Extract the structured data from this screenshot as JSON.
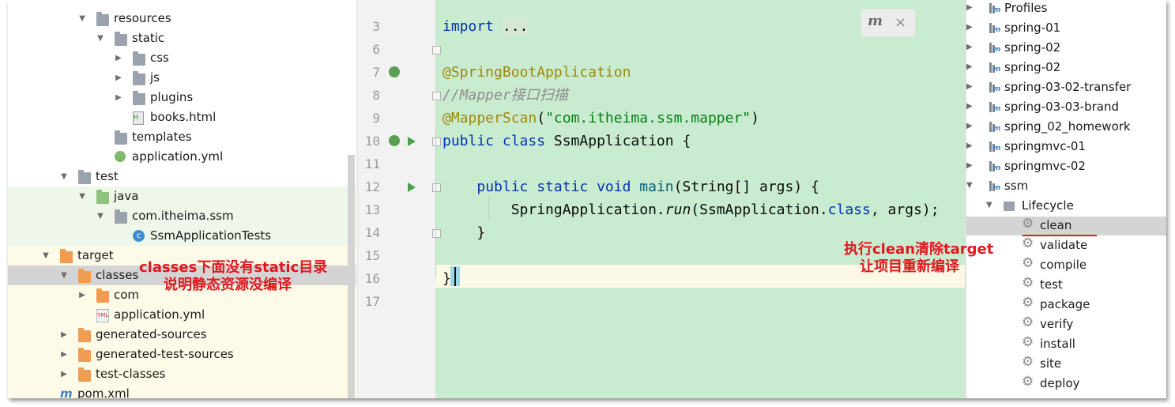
{
  "project_tree": {
    "rows": [
      {
        "label": "resources",
        "indent": 3,
        "icon": "resources-folder-icon",
        "arrow": "down"
      },
      {
        "label": "static",
        "indent": 4,
        "icon": "folder-icon",
        "arrow": "down"
      },
      {
        "label": "css",
        "indent": 5,
        "icon": "folder-icon",
        "arrow": "right"
      },
      {
        "label": "js",
        "indent": 5,
        "icon": "folder-icon",
        "arrow": "right"
      },
      {
        "label": "plugins",
        "indent": 5,
        "icon": "folder-icon",
        "arrow": "right"
      },
      {
        "label": "books.html",
        "indent": 5,
        "icon": "html-file-icon",
        "arrow": ""
      },
      {
        "label": "templates",
        "indent": 4,
        "icon": "folder-icon",
        "arrow": ""
      },
      {
        "label": "application.yml",
        "indent": 4,
        "icon": "spring-config-icon",
        "arrow": ""
      },
      {
        "label": "test",
        "indent": 2,
        "icon": "folder-icon",
        "arrow": "down"
      },
      {
        "label": "java",
        "indent": 3,
        "icon": "test-source-folder-icon",
        "arrow": "down"
      },
      {
        "label": "com.itheima.ssm",
        "indent": 4,
        "icon": "package-icon",
        "arrow": "down"
      },
      {
        "label": "SsmApplicationTests",
        "indent": 5,
        "icon": "class-icon",
        "arrow": ""
      },
      {
        "label": "target",
        "indent": 1,
        "icon": "excluded-folder-icon",
        "arrow": "down"
      },
      {
        "label": "classes",
        "indent": 2,
        "icon": "excluded-folder-icon",
        "arrow": "down"
      },
      {
        "label": "com",
        "indent": 3,
        "icon": "excluded-folder-icon",
        "arrow": "right"
      },
      {
        "label": "application.yml",
        "indent": 3,
        "icon": "yml-file-icon",
        "arrow": ""
      },
      {
        "label": "generated-sources",
        "indent": 2,
        "icon": "excluded-folder-icon",
        "arrow": "right"
      },
      {
        "label": "generated-test-sources",
        "indent": 2,
        "icon": "excluded-folder-icon",
        "arrow": "right"
      },
      {
        "label": "test-classes",
        "indent": 2,
        "icon": "excluded-folder-icon",
        "arrow": "right"
      },
      {
        "label": "pom.xml",
        "indent": 1,
        "icon": "maven-file-icon",
        "arrow": ""
      }
    ],
    "selected_label": "classes"
  },
  "editor": {
    "lines": [
      {
        "num": "3",
        "html": "<span class='kw'>import</span> <span style='background:#d6e8d2'>...</span>"
      },
      {
        "num": "6",
        "html": ""
      },
      {
        "num": "7",
        "html": "<span class='an'>@SpringBootApplication</span>"
      },
      {
        "num": "8",
        "html": "<span class='cm'>//Mapper接口扫描</span>"
      },
      {
        "num": "9",
        "html": "<span class='an'>@MapperScan</span>(<span class='str'>\"com.itheima.ssm.mapper\"</span>)"
      },
      {
        "num": "10",
        "html": "<span class='kw'>public class</span> SsmApplication {"
      },
      {
        "num": "11",
        "html": ""
      },
      {
        "num": "12",
        "html": "    <span class='kw'>public static void</span> <span class='fn'>main</span>(String[] args) {"
      },
      {
        "num": "13",
        "html": "        SpringApplication.<span class='it'>run</span>(SsmApplication.<span class='kw'>class</span>, args);"
      },
      {
        "num": "14",
        "html": "    }"
      },
      {
        "num": "15",
        "html": ""
      },
      {
        "num": "16",
        "html": "}"
      },
      {
        "num": "17",
        "html": ""
      }
    ],
    "popup_icon": "maven-reload-icon",
    "popup_close": "×"
  },
  "maven": {
    "projects": [
      "Profiles",
      "spring-01",
      "spring-02",
      "spring-02",
      "spring-03-02-transfer",
      "spring-03-03-brand",
      "spring_02_homework",
      "springmvc-01",
      "springmvc-02",
      "ssm"
    ],
    "lifecycle_label": "Lifecycle",
    "goals": [
      "clean",
      "validate",
      "compile",
      "test",
      "package",
      "verify",
      "install",
      "site",
      "deploy"
    ],
    "selected_goal": "clean"
  },
  "annotations": {
    "left_line1": "classes下面没有static目录",
    "left_line2": "说明静态资源没编译",
    "right_line1": "执行clean清除target",
    "right_line2": "让项目重新编译"
  },
  "colors": {
    "editor_bg": "#c9ebcf",
    "annotation": "#e1181f",
    "selection": "#d4d4d4"
  }
}
